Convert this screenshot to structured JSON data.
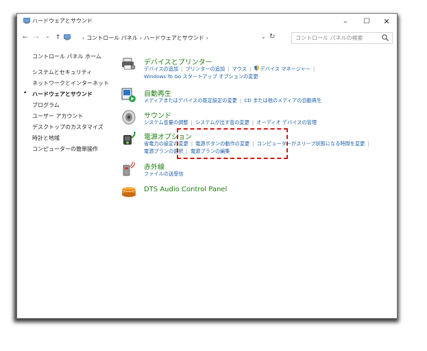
{
  "window": {
    "title": "ハードウェアとサウンド",
    "minimize": "–",
    "maximize": "☐",
    "close": "✕"
  },
  "address_bar": {
    "back": "←",
    "forward": "→",
    "recent": "⌄",
    "up": "↑",
    "crumbs": [
      "コントロール パネル",
      "ハードウェアとサウンド"
    ],
    "crumb_sep": "›",
    "dropdown": "⌄",
    "refresh": "↻",
    "search_placeholder": "コントロール パネルの検索"
  },
  "sidebar": {
    "items": [
      {
        "label": "コントロール パネル ホーム"
      },
      {
        "label": "システムとセキュリティ"
      },
      {
        "label": "ネットワークとインターネット"
      },
      {
        "label": "ハードウェアとサウンド",
        "active": true
      },
      {
        "label": "プログラム"
      },
      {
        "label": "ユーザー アカウント"
      },
      {
        "label": "デスクトップのカスタマイズ"
      },
      {
        "label": "時計と地域"
      },
      {
        "label": "コンピューターの簡単操作"
      }
    ],
    "bullet": "•"
  },
  "categories": {
    "devices": {
      "title": "デバイスとプリンター",
      "icon": "printer-icon",
      "links_row1": [
        "デバイスの追加",
        "プリンターの追加",
        "マウス",
        "デバイス マネージャー"
      ],
      "links_row2": [
        "Windows To Go スタートアップ オプションの変更"
      ]
    },
    "autoplay": {
      "title": "自動再生",
      "icon": "autoplay-icon",
      "links_row1": [
        "メディアまたはデバイスの既定設定の変更",
        "CD または他のメディアの自動再生"
      ]
    },
    "sound": {
      "title": "サウンド",
      "icon": "speaker-icon",
      "links_row1": [
        "システム音量の調整",
        "システムが出す音の変更",
        "オーディオ デバイスの管理"
      ]
    },
    "power": {
      "title": "電源オプション",
      "icon": "power-icon",
      "links_row1": [
        "省電力の設定の変更",
        "電源ボタンの動作の変更",
        "コンピューターがスリープ状態になる時間を変更"
      ],
      "links_row2": [
        "電源プランの選択",
        "電源プランの編集"
      ]
    },
    "infrared": {
      "title": "赤外線",
      "icon": "infrared-icon",
      "links_row1": [
        "ファイルの送受信"
      ]
    },
    "dts": {
      "title": "DTS Audio Control Panel",
      "icon": "dts-icon"
    }
  },
  "colors": {
    "category_title": "#1e7d12",
    "link": "#1b5ea8",
    "highlight": "#d50f0f"
  }
}
